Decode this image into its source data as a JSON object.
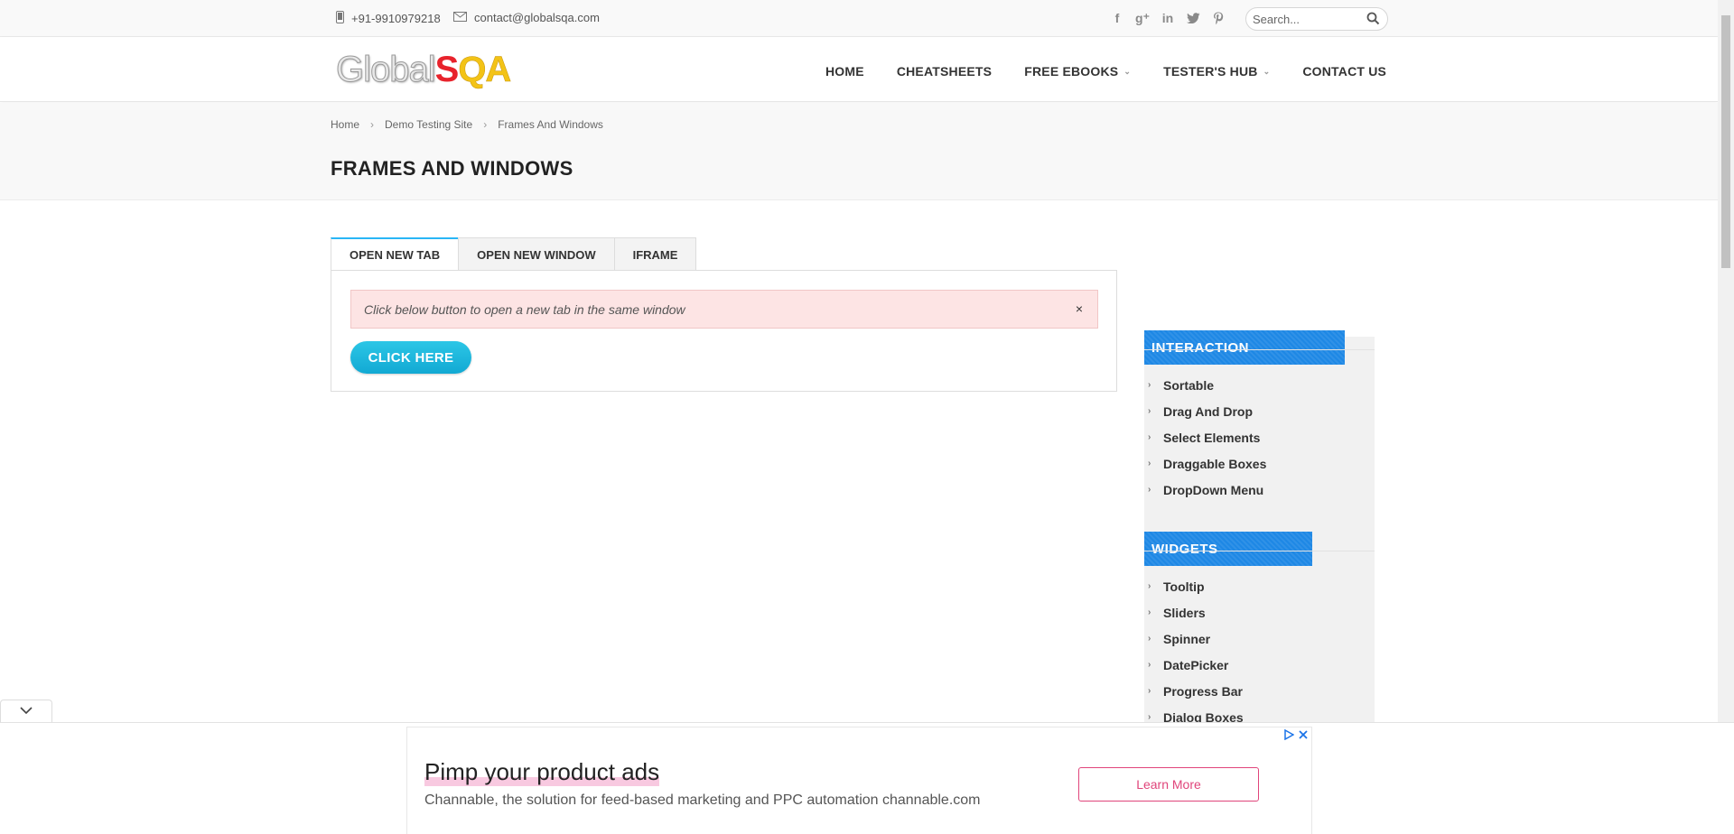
{
  "topbar": {
    "phone": "+91-9910979218",
    "email": "contact@globalsqa.com",
    "search_placeholder": "Search..."
  },
  "logo": {
    "part1": "Global",
    "part2": "S",
    "part3": "QA"
  },
  "nav": {
    "home": "HOME",
    "cheatsheets": "CHEATSHEETS",
    "ebooks": "FREE EBOOKS",
    "hub": "TESTER'S HUB",
    "contact": "CONTACT US"
  },
  "breadcrumb": {
    "home": "Home",
    "demo": "Demo Testing Site",
    "current": "Frames And Windows",
    "sep": "›"
  },
  "page_title": "FRAMES AND WINDOWS",
  "tabs": {
    "tab1": "OPEN NEW TAB",
    "tab2": "OPEN NEW WINDOW",
    "tab3": "IFRAME"
  },
  "panel": {
    "alert_text": "Click below button to open a new tab in the same window",
    "close": "×",
    "button": "CLICK HERE"
  },
  "sidebar": {
    "interaction_title": "INTERACTION",
    "interaction_items": [
      "Sortable",
      "Drag And Drop",
      "Select Elements",
      "Draggable Boxes",
      "DropDown Menu"
    ],
    "widgets_title": "WIDGETS",
    "widgets_items": [
      "Tooltip",
      "Sliders",
      "Spinner",
      "DatePicker",
      "Progress Bar",
      "Dialog Boxes"
    ]
  },
  "ad": {
    "headline": "Pimp your product ads",
    "sub": "Channable, the solution for feed-based marketing and PPC automation channable.com",
    "cta": "Learn More"
  },
  "colors": {
    "accent": "#29b6f6",
    "button": "#12a9d3",
    "sidebar_head": "#1e88e5",
    "alert_bg": "#fde4e4",
    "ad_cta": "#e0457b"
  },
  "icons": [
    "phone-icon",
    "mail-icon",
    "facebook-icon",
    "google-plus-icon",
    "linkedin-icon",
    "twitter-icon",
    "pinterest-icon",
    "search-icon",
    "close-icon",
    "chevron-right-icon",
    "chevron-down-icon",
    "adchoices-icon"
  ]
}
